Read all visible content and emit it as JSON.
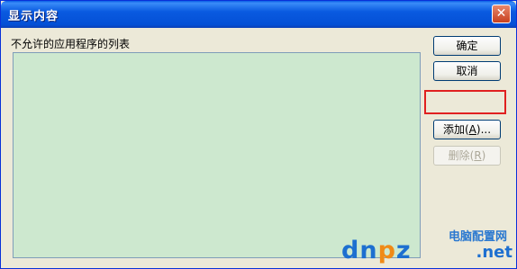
{
  "window": {
    "title": "显示内容",
    "close_glyph": "✕"
  },
  "list": {
    "label": "不允许的应用程序的列表",
    "background": "#cde8cf"
  },
  "buttons": {
    "ok": "确定",
    "cancel": "取消",
    "add_pre": "添加(",
    "add_key": "A",
    "add_post": ")...",
    "delete_pre": "删除(",
    "delete_key": "R",
    "delete_post": ")"
  },
  "watermark": {
    "top": "电脑配置网",
    "main_a": "dn",
    "main_o": "p",
    "main_b": "z",
    "tld": ".net"
  },
  "colors": {
    "title_bar": "#0a5ae0",
    "highlight": "#e02020"
  }
}
